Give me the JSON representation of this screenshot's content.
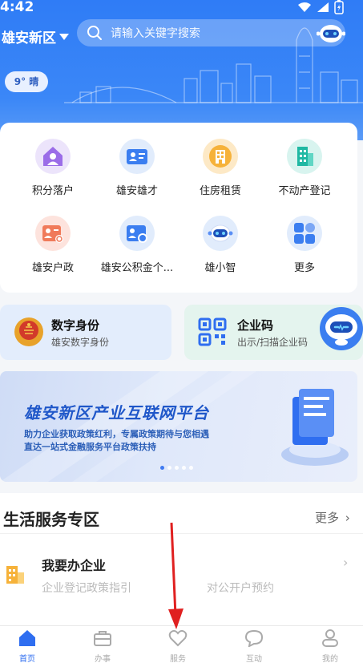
{
  "status": {
    "time": "4:42"
  },
  "header": {
    "location": "雄安新区",
    "search_placeholder": "请输入关键字搜索",
    "weather": "9° 晴"
  },
  "services": [
    {
      "label": "积分落户",
      "icon": "house-person-icon"
    },
    {
      "label": "雄安雄才",
      "icon": "id-card-icon"
    },
    {
      "label": "住房租赁",
      "icon": "building-icon"
    },
    {
      "label": "不动产登记",
      "icon": "tall-building-icon"
    },
    {
      "label": "雄安户政",
      "icon": "household-register-icon"
    },
    {
      "label": "雄安公积金个...",
      "icon": "fund-card-icon"
    },
    {
      "label": "雄小智",
      "icon": "robot-icon"
    },
    {
      "label": "更多",
      "icon": "more-grid-icon"
    }
  ],
  "quick_cards": {
    "digital_id": {
      "title": "数字身份",
      "subtitle": "雄安数字身份"
    },
    "enterprise_code": {
      "title": "企业码",
      "subtitle": "出示/扫描企业码"
    }
  },
  "banner": {
    "headline": "雄安新区产业互联网平台",
    "line1": "助力企业获取政策红利，专属政策期待与您相遇",
    "line2": "直达一站式金融服务平台政策扶持",
    "active_page": 1,
    "page_count": 5
  },
  "life_services": {
    "title": "生活服务专区",
    "more": "更多",
    "item": {
      "title": "我要办企业",
      "sub1": "企业登记政策指引",
      "sub2": "对公开户预约"
    }
  },
  "tabbar": [
    {
      "label": "首页",
      "icon": "home-icon",
      "active": true
    },
    {
      "label": "办事",
      "icon": "briefcase-icon",
      "active": false
    },
    {
      "label": "服务",
      "icon": "heart-icon",
      "active": false
    },
    {
      "label": "互动",
      "icon": "chat-icon",
      "active": false
    },
    {
      "label": "我的",
      "icon": "user-icon",
      "active": false
    }
  ],
  "colors": {
    "primary": "#2f6ef0",
    "hero": "#2f7cf6"
  }
}
